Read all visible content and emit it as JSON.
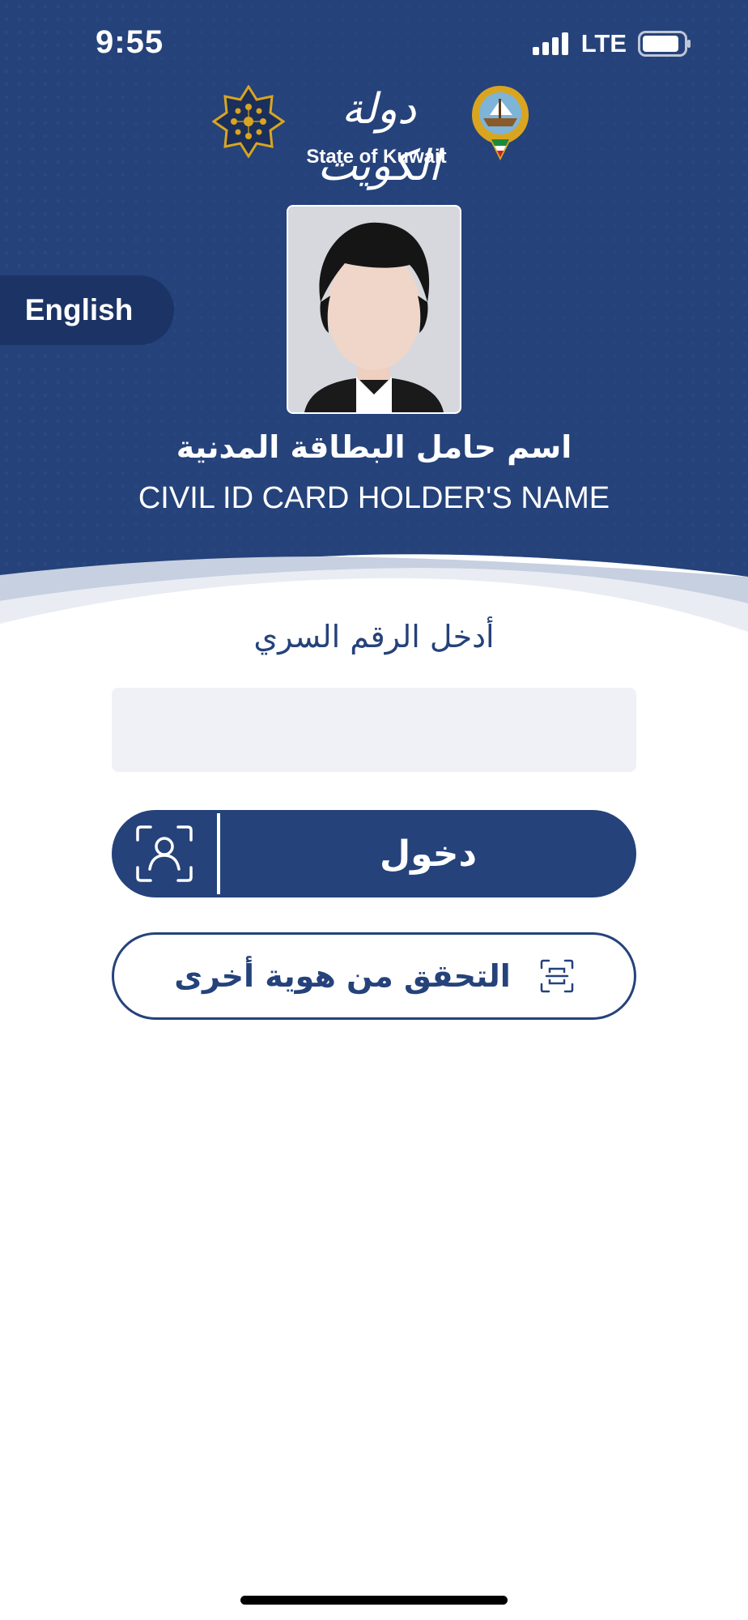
{
  "status_bar": {
    "time": "9:55",
    "network": "LTE"
  },
  "header": {
    "logo_arabic": "دولة الكويت",
    "logo_english": "State of Kuwait",
    "language_toggle": "English",
    "holder_name_ar": "اسم حامل البطاقة المدنية",
    "holder_name_en": "CIVIL ID CARD HOLDER'S NAME"
  },
  "form": {
    "pin_label": "أدخل الرقم السري",
    "pin_value": "",
    "login_label": "دخول",
    "verify_other_label": "التحقق من هوية أخرى"
  },
  "colors": {
    "primary": "#25427a",
    "header_dark": "#1c3465",
    "input_bg": "#f0f1f6",
    "gold": "#d9a520"
  },
  "icons": {
    "face_id": "face-id-icon",
    "scan": "scan-icon",
    "emblem": "star-emblem",
    "coat_of_arms": "coat-of-arms"
  }
}
